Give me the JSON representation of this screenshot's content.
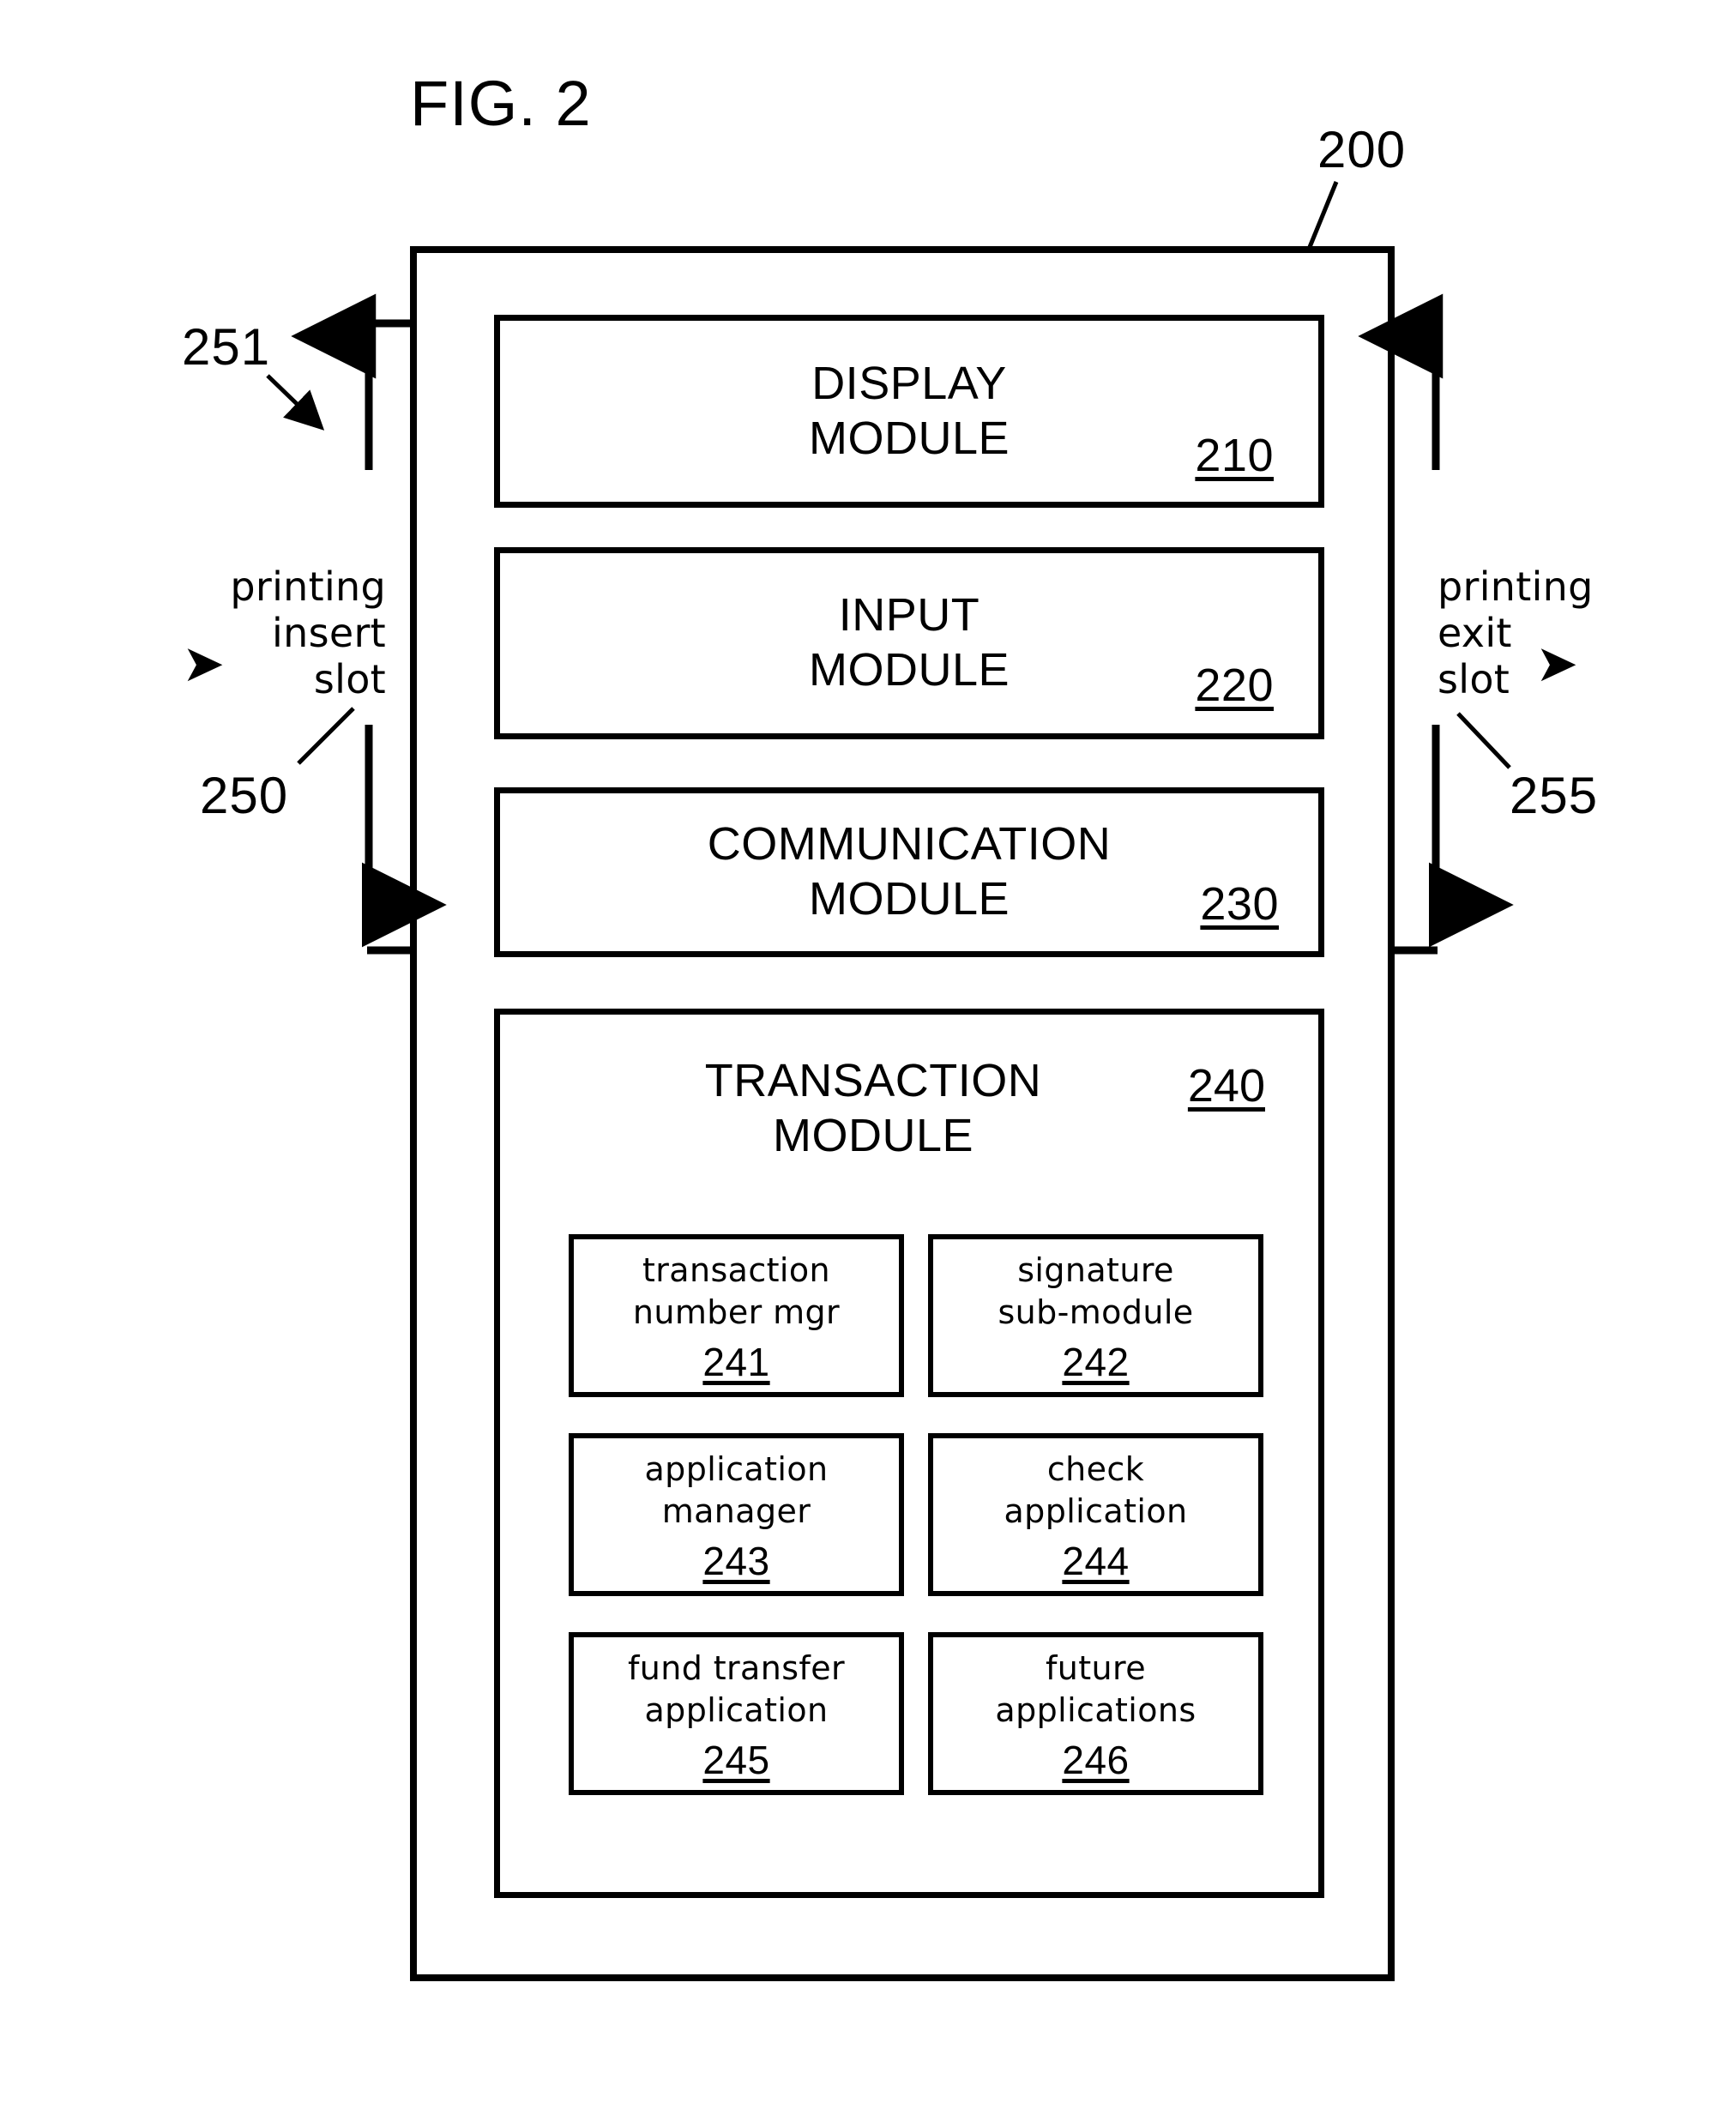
{
  "figure": {
    "title": "FIG. 2",
    "device_ref": "200"
  },
  "modules": [
    {
      "name": "display-module",
      "title": "DISPLAY\nMODULE",
      "ref": "210"
    },
    {
      "name": "input-module",
      "title": "INPUT\nMODULE",
      "ref": "220"
    },
    {
      "name": "communication-module",
      "title": "COMMUNICATION\nMODULE",
      "ref": "230"
    }
  ],
  "transaction_module": {
    "title": "TRANSACTION\nMODULE",
    "ref": "240",
    "sub_modules": [
      {
        "name": "transaction-number-mgr",
        "label": "transaction\nnumber mgr",
        "ref": "241"
      },
      {
        "name": "signature-sub-module",
        "label": "signature\nsub-module",
        "ref": "242"
      },
      {
        "name": "application-manager",
        "label": "application\nmanager",
        "ref": "243"
      },
      {
        "name": "check-application",
        "label": "check\napplication",
        "ref": "244"
      },
      {
        "name": "fund-transfer-application",
        "label": "fund transfer\napplication",
        "ref": "245"
      },
      {
        "name": "future-applications",
        "label": "future\napplications",
        "ref": "246"
      }
    ]
  },
  "annotations": {
    "insert_slot_label": "printing\ninsert\nslot",
    "insert_slot_arrow": "➤",
    "insert_slot_ref": "250",
    "insert_span_ref": "251",
    "exit_slot_label": "printing\nexit\nslot",
    "exit_slot_arrow": "➤",
    "exit_slot_ref": "255"
  },
  "colors": {
    "ink": "#000000",
    "paper": "#ffffff"
  }
}
